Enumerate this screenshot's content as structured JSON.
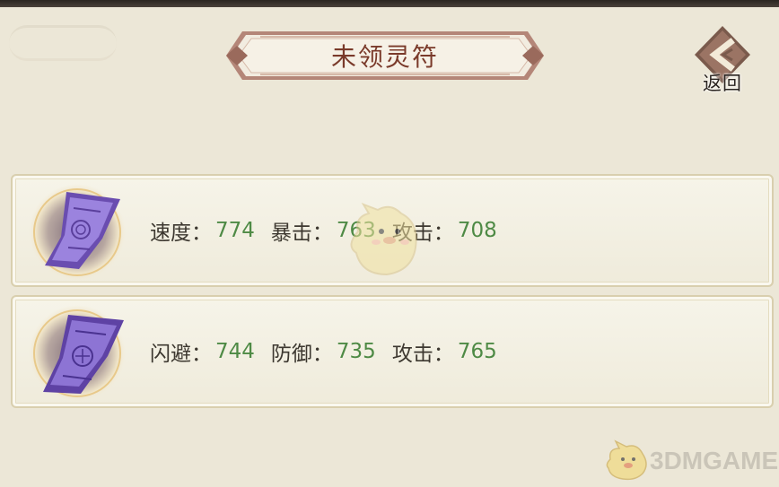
{
  "header": {
    "title": "未领灵符",
    "back_label": "返回"
  },
  "talismans": [
    {
      "stats": [
        {
          "label": "速度",
          "sep": "：",
          "value": "774"
        },
        {
          "label": "暴击",
          "sep": "：",
          "value": "763"
        },
        {
          "label": "攻击",
          "sep": "：",
          "value": "708"
        }
      ]
    },
    {
      "stats": [
        {
          "label": "闪避",
          "sep": "：",
          "value": "744"
        },
        {
          "label": "防御",
          "sep": "：",
          "value": "735"
        },
        {
          "label": "攻击",
          "sep": "：",
          "value": "765"
        }
      ]
    }
  ],
  "watermark": "3DMGAME",
  "colors": {
    "background": "#ece7d7",
    "title_text": "#7a3a2a",
    "stat_value": "#4e8a45",
    "talisman_purple": "#7a5fc0"
  }
}
